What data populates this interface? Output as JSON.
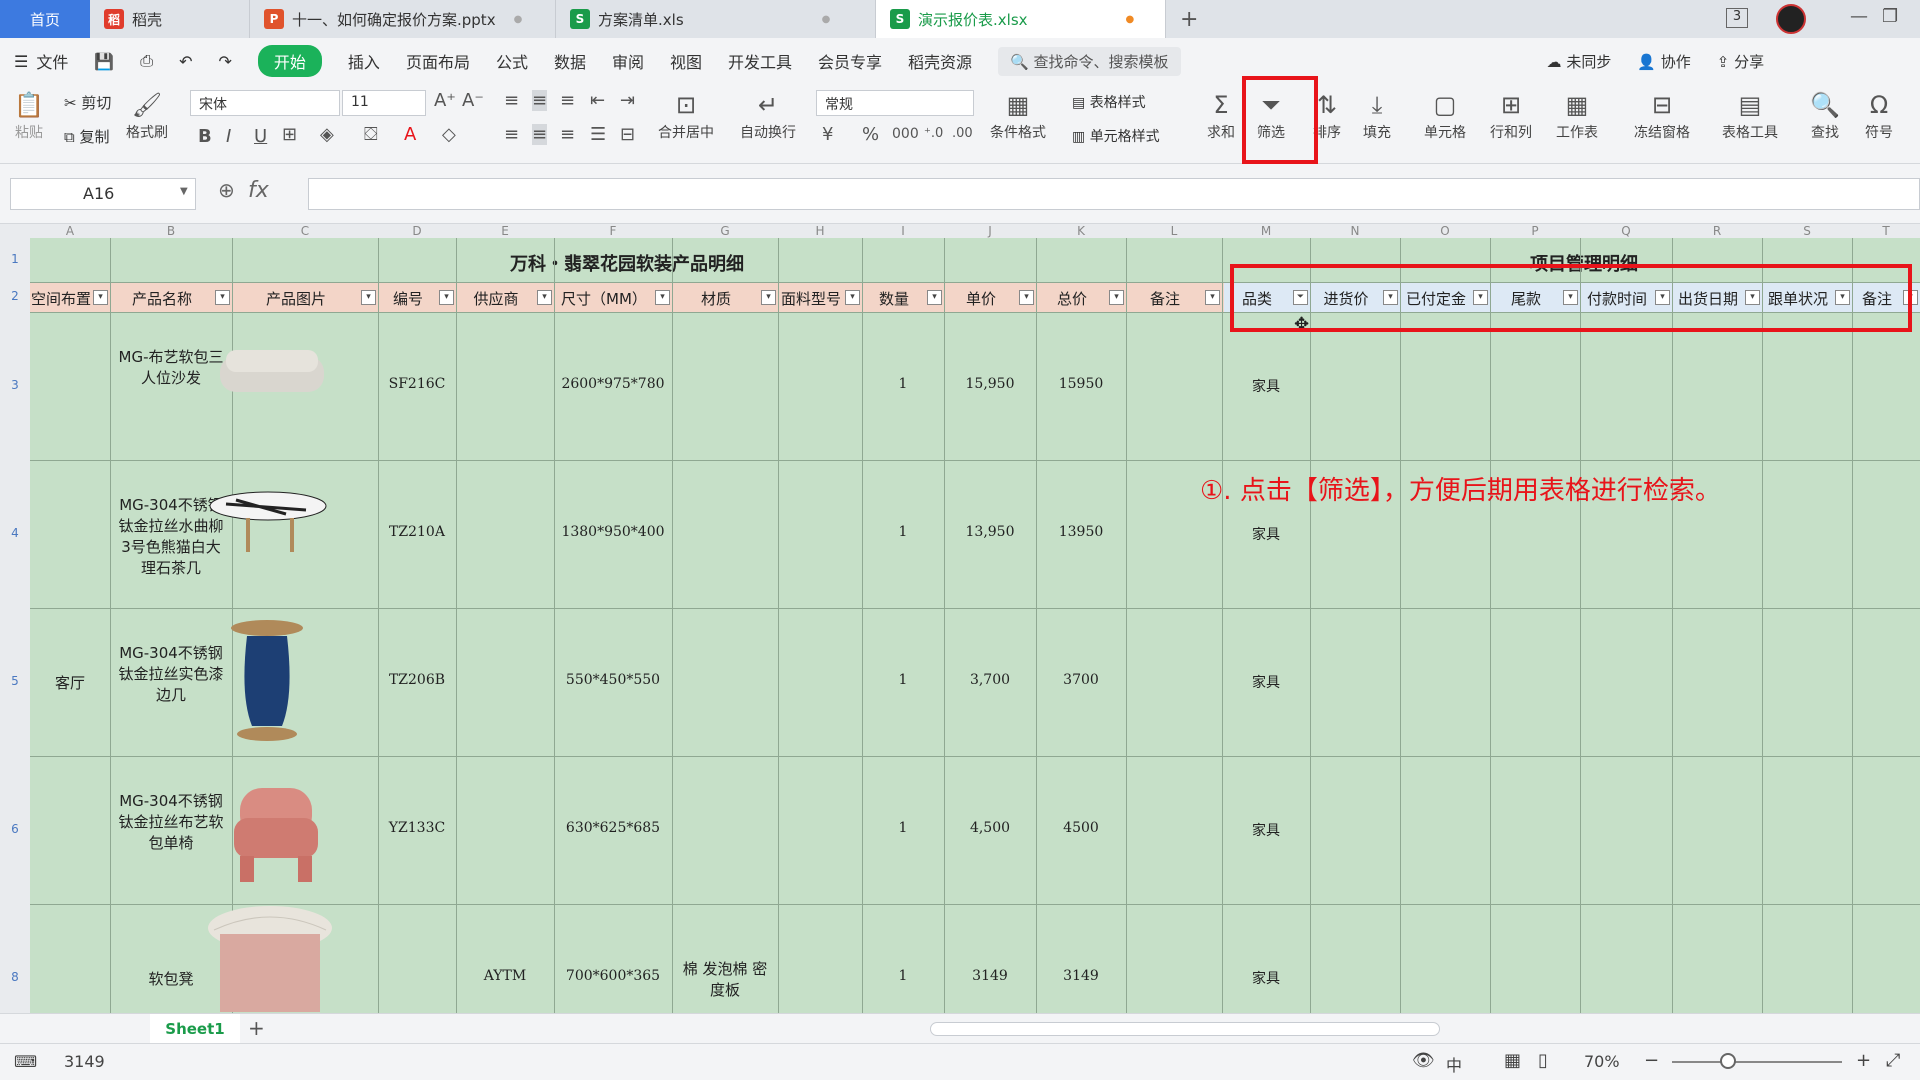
{
  "tabs": {
    "home": "首页",
    "t1": "稻壳",
    "t2": "十一、如何确定报价方案.pptx",
    "t3": "方案清单.xls",
    "t4": "演示报价表.xlsx",
    "add": "+",
    "count": "3"
  },
  "menu": {
    "file": "文件",
    "items": [
      "开始",
      "插入",
      "页面布局",
      "公式",
      "数据",
      "审阅",
      "视图",
      "开发工具",
      "会员专享",
      "稻壳资源"
    ],
    "search": "查找命令、搜索模板",
    "sync": "未同步",
    "collab": "协作",
    "share": "分享"
  },
  "ribbon": {
    "paste": "粘贴",
    "cut": "剪切",
    "copy": "复制",
    "format_painter": "格式刷",
    "font": "宋体",
    "size": "11",
    "merge": "合并居中",
    "wrap": "自动换行",
    "numfmt": "常规",
    "cond": "条件格式",
    "table_style": "表格样式",
    "cell_style": "单元格样式",
    "sum": "求和",
    "filter": "筛选",
    "sort": "排序",
    "fill": "填充",
    "cell": "单元格",
    "rowcol": "行和列",
    "sheet": "工作表",
    "freeze": "冻结窗格",
    "tools": "表格工具",
    "find": "查找",
    "symbol": "符号"
  },
  "formula_bar": {
    "cell_ref": "A16",
    "fx": "fx"
  },
  "columns": [
    "A",
    "B",
    "C",
    "D",
    "E",
    "F",
    "G",
    "H",
    "I",
    "J",
    "K",
    "L",
    "M",
    "N",
    "O",
    "P",
    "Q",
    "R",
    "S",
    "T"
  ],
  "rows": [
    "1",
    "2",
    "3",
    "4",
    "5",
    "6",
    "8"
  ],
  "sheet": {
    "title_left": "万科・翡翠花园软装产品明细",
    "title_right": "项目管理明细",
    "headers": [
      "空间布置",
      "产品名称",
      "产品图片",
      "编号",
      "供应商",
      "尺寸（MM）",
      "材质",
      "面料型号",
      "数量",
      "单价",
      "总价",
      "备注",
      "品类",
      "进货价",
      "已付定金",
      "尾款",
      "付款时间",
      "出货日期",
      "跟单状况",
      "备注"
    ],
    "room": "客厅",
    "products": [
      {
        "name": "MG-布艺软包三人位沙发",
        "code": "SF216C",
        "supplier": "",
        "size": "2600*975*780",
        "material": "",
        "qty": "1",
        "price": "15,950",
        "total": "15950",
        "cat": "家具"
      },
      {
        "name": "MG-304不锈钢钛金拉丝水曲柳3号色熊猫白大理石茶几",
        "code": "TZ210A",
        "supplier": "",
        "size": "1380*950*400",
        "material": "",
        "qty": "1",
        "price": "13,950",
        "total": "13950",
        "cat": "家具"
      },
      {
        "name": "MG-304不锈钢钛金拉丝实色漆边几",
        "code": "TZ206B",
        "supplier": "",
        "size": "550*450*550",
        "material": "",
        "qty": "1",
        "price": "3,700",
        "total": "3700",
        "cat": "家具"
      },
      {
        "name": "MG-304不锈钢钛金拉丝布艺软包单椅",
        "code": "YZ133C",
        "supplier": "",
        "size": "630*625*685",
        "material": "",
        "qty": "1",
        "price": "4,500",
        "total": "4500",
        "cat": "家具"
      },
      {
        "name": "软包凳",
        "code": "",
        "supplier": "AYTM",
        "size": "700*600*365",
        "material": "棉 发泡棉 密度板",
        "qty": "1",
        "price": "3149",
        "total": "3149",
        "cat": "家具"
      }
    ]
  },
  "annotation": "①. 点击【筛选】，方便后期用表格进行检索。",
  "sheet_tab": "Sheet1",
  "status": {
    "value": "3149",
    "zoom": "70%"
  }
}
